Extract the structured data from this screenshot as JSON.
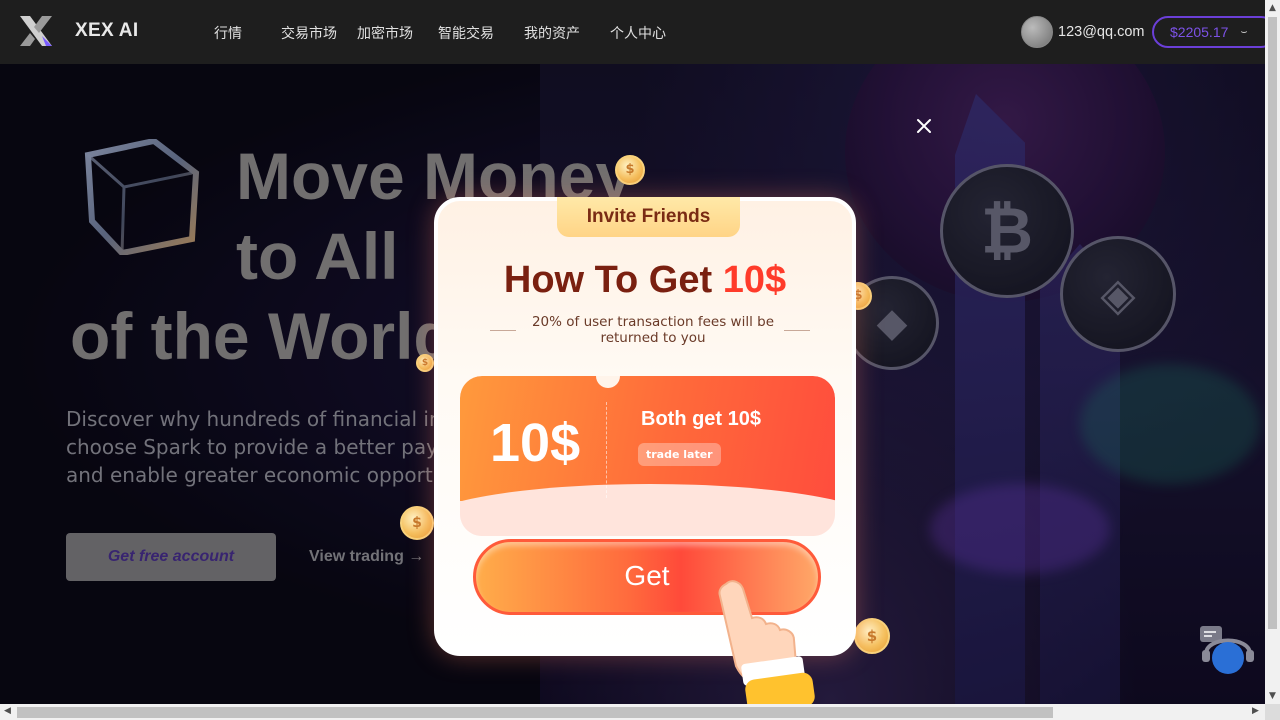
{
  "header": {
    "logo_text": "XEX AI",
    "nav": [
      "行情",
      "交易市场",
      "加密市场",
      "智能交易",
      "我的资产",
      "个人中心"
    ],
    "user_email": "123@qq.com",
    "balance": "$2205.17"
  },
  "hero": {
    "title_lines": [
      "Move Money",
      "to All",
      "of the World"
    ],
    "subtitle_lines": [
      "Discover why hundreds of financial institutions",
      "choose Spark to provide a better payment",
      "and enable greater economic opportunity"
    ],
    "primary_cta": "Get free account",
    "secondary_cta": "View trading →"
  },
  "modal": {
    "tab_label": "Invite Friends",
    "title_prefix": "How To Get ",
    "title_accent": "10$",
    "description": "20% of user transaction fees will be returned to you",
    "ticket_amount": "10$",
    "ticket_headline": "Both get 10$",
    "ticket_badge": "trade later",
    "get_button": "Get"
  },
  "colors": {
    "brand_accent": "#6b3fd8",
    "ticket_orange": "#ff6a3a",
    "title_accent": "#ff3b2a"
  }
}
